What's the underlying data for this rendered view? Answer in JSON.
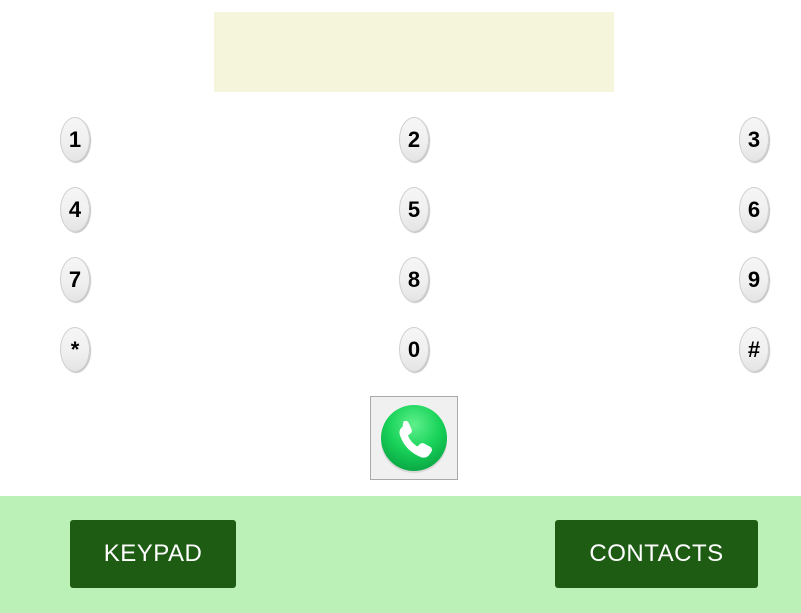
{
  "display": {
    "value": ""
  },
  "keypad": {
    "keys": [
      "1",
      "2",
      "3",
      "4",
      "5",
      "6",
      "7",
      "8",
      "9",
      "*",
      "0",
      "#"
    ]
  },
  "call": {
    "icon": "phone-icon",
    "color": "#19d35a"
  },
  "footer": {
    "background": "#bbf1b6",
    "keypad_label": "KEYPAD",
    "contacts_label": "CONTACTS",
    "button_color": "#1e5c14"
  }
}
